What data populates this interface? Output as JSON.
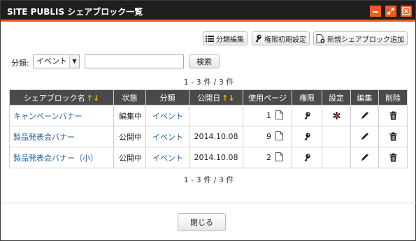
{
  "window": {
    "title": "SITE PUBLIS シェアブロック一覧"
  },
  "toolbar": {
    "category_edit": "分類編集",
    "permission_init": "権限初期設定",
    "new_shareblock": "新規シェアブロック追加"
  },
  "filter": {
    "label": "分類:",
    "selected": "イベント",
    "search_value": "",
    "search_button": "検索"
  },
  "pager": {
    "top": "1 - 3 件 / 3 件",
    "bottom": "1 - 3 件 / 3 件"
  },
  "table": {
    "headers": {
      "name": "シェアブロック名",
      "status": "状態",
      "category": "分類",
      "published": "公開日",
      "usage": "使用ページ",
      "permission": "権限",
      "settings": "設定",
      "edit": "編集",
      "delete": "削除"
    },
    "rows": [
      {
        "name": "キャンペーンバナー",
        "status": "編集中",
        "category": "イベント",
        "published": "",
        "usage": "1"
      },
      {
        "name": "製品発表会バナー",
        "status": "公開中",
        "category": "イベント",
        "published": "2014.10.08",
        "usage": "9"
      },
      {
        "name": "製品発表会バナー（小）",
        "status": "公開中",
        "category": "イベント",
        "published": "2014.10.08",
        "usage": "2"
      }
    ]
  },
  "footer": {
    "close": "閉じる"
  },
  "colors": {
    "accent": "#e85b1f",
    "titlebar": "#1f1f1f",
    "header": "#4a4a4a",
    "link": "#1e5d99",
    "sort_arrow": "#f4c20d"
  }
}
